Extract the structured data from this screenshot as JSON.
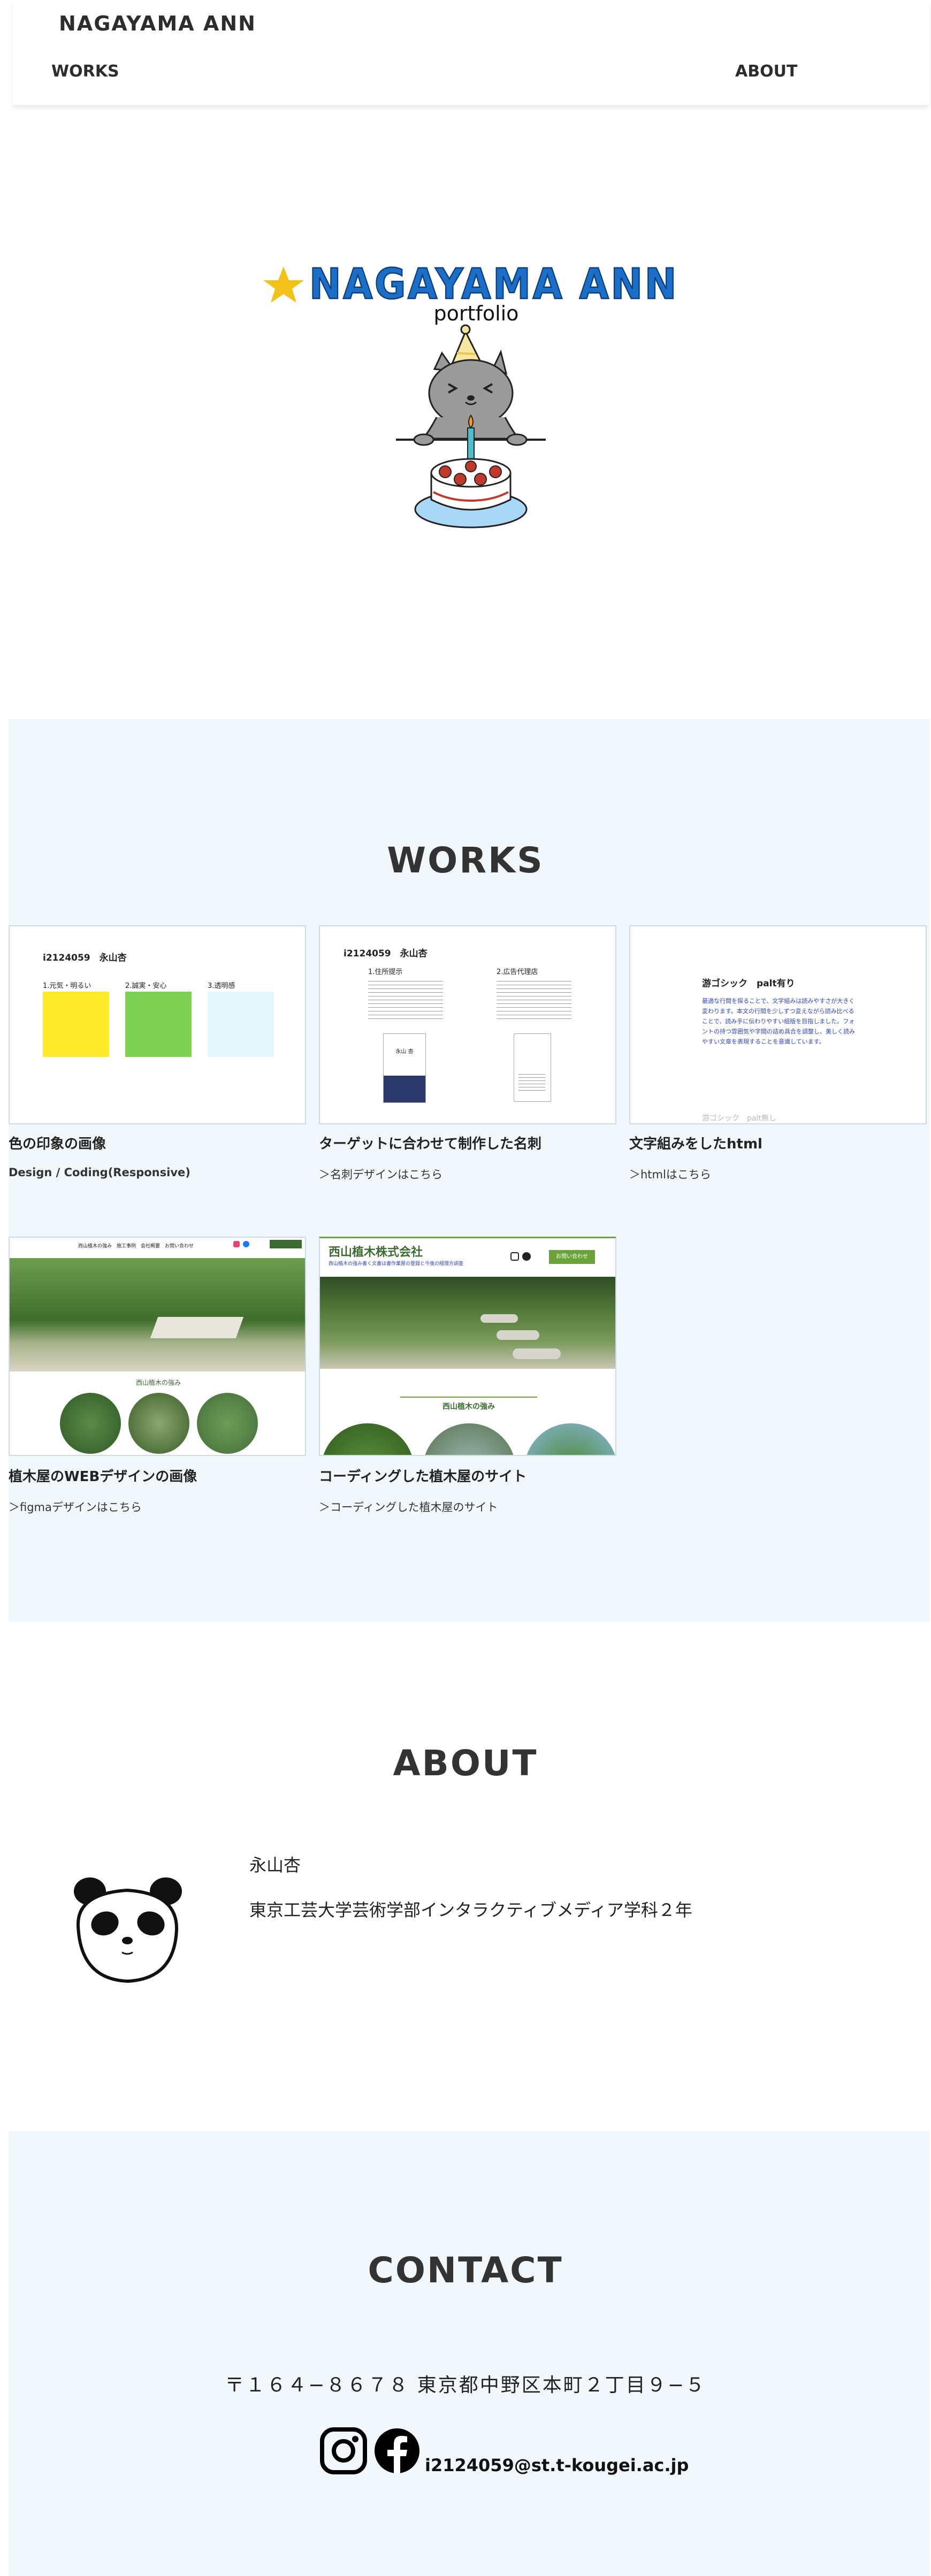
{
  "header": {
    "brand": "NAGAYAMA ANN",
    "nav": {
      "works": "WORKS",
      "about": "ABOUT"
    }
  },
  "hero": {
    "title": "NAGAYAMA ANN",
    "subtitle": "portfolio"
  },
  "works": {
    "title": "WORKS",
    "items": [
      {
        "title": "色の印象の画像",
        "sub": "Design / Coding(Responsive)",
        "thumb": {
          "heading": "i2124059　永山杏",
          "labels": [
            "1.元気・明るい",
            "2.誠実・安心",
            "3.透明感"
          ],
          "colors": [
            "#fdea2a",
            "#7dd351",
            "#e4f7fd"
          ]
        }
      },
      {
        "title": "ターゲットに合わせて制作した名刺",
        "sub": "＞名刺デザインはこちら",
        "thumb": {
          "heading": "i2124059　永山杏",
          "labels": [
            "1.住所提示",
            "2.広告代理店"
          ],
          "card_name": "永山 杏"
        }
      },
      {
        "title": "文字組みをしたhtml",
        "sub": "＞htmlはこちら",
        "thumb": {
          "heading": "游ゴシック　palt有り",
          "body": "最適な行間を探ることで、文字組みは読みやすさが大きく変わります。本文の行間を少しずつ変えながら読み比べることで、読み手に伝わりやすい組版を目指しました。フォントの持つ雰囲気や字間の詰め具合を調整し、美しく読みやすい文章を表現することを意識しています。",
          "footer": "游ゴシック　palt無し"
        }
      },
      {
        "title": "植木屋のWEBデザインの画像",
        "sub": "＞figmaデザインはこちら",
        "thumb": {
          "nav": "西山植木の強み　施工事例　会社概要　お問い合わせ",
          "section": "西山植木の強み"
        }
      },
      {
        "title": "コーディングした植木屋のサイト",
        "sub": "＞コーディングした植木屋のサイト",
        "thumb": {
          "company": "西山植木株式会社",
          "tagline": "西山植木の強み書く文書は書作業屋の登録と今後の経理方調査",
          "button": "お問い合わせ",
          "section": "西山植木の強み"
        }
      }
    ]
  },
  "about": {
    "title": "ABOUT",
    "name": "永山杏",
    "department": "東京工芸大学芸術学部インタラクティブメディア学科２年"
  },
  "contact": {
    "title": "CONTACT",
    "address": "〒１６４−８６７８ 東京都中野区本町２丁目９−５",
    "email": "i2124059@st.t-kougei.ac.jp"
  },
  "colors": {
    "hero_blue": "#1b6fc7",
    "star_yellow": "#f2c21a",
    "section_bg": "#f2f7fb"
  }
}
